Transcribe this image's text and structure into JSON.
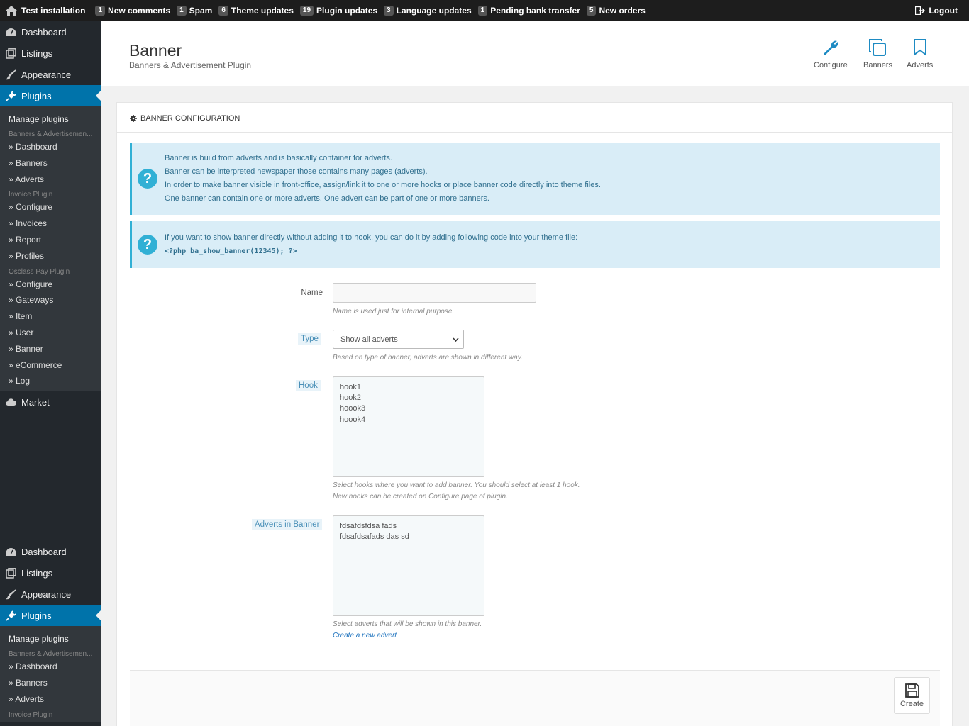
{
  "topbar": {
    "site_name": "Test installation",
    "notifications": [
      {
        "count": "1",
        "label": "New comments"
      },
      {
        "count": "1",
        "label": "Spam"
      },
      {
        "count": "6",
        "label": "Theme updates"
      },
      {
        "count": "19",
        "label": "Plugin updates"
      },
      {
        "count": "3",
        "label": "Language updates"
      },
      {
        "count": "1",
        "label": "Pending bank transfer"
      },
      {
        "count": "5",
        "label": "New orders"
      }
    ],
    "logout": "Logout"
  },
  "sidebar": {
    "main": [
      "Dashboard",
      "Listings",
      "Appearance",
      "Plugins"
    ],
    "manage_plugins": "Manage plugins",
    "groups": [
      {
        "title": "Banners & Advertisemen...",
        "items": [
          "» Dashboard",
          "» Banners",
          "» Adverts"
        ]
      },
      {
        "title": "Invoice Plugin",
        "items": [
          "» Configure",
          "» Invoices",
          "» Report",
          "» Profiles"
        ]
      },
      {
        "title": "Osclass Pay Plugin",
        "items": [
          "» Configure",
          "» Gateways",
          "» Item",
          "» User",
          "» Banner",
          "» eCommerce",
          "» Log"
        ]
      }
    ],
    "market": "Market",
    "repeat_main": [
      "Dashboard",
      "Listings",
      "Appearance",
      "Plugins"
    ],
    "repeat_manage": "Manage plugins",
    "repeat_group_title": "Banners & Advertisemen...",
    "repeat_items": [
      "» Dashboard",
      "» Banners",
      "» Adverts"
    ],
    "repeat_group2_title": "Invoice Plugin"
  },
  "header": {
    "title": "Banner",
    "subtitle": "Banners & Advertisement Plugin",
    "buttons": [
      "Configure",
      "Banners",
      "Adverts"
    ]
  },
  "panel": {
    "title": "Banner configuration",
    "info1": [
      "Banner is build from adverts and is basically container for adverts.",
      "Banner can be interpreted newspaper those contains many pages (adverts).",
      "In order to make banner visible in front-office, assign/link it to one or more hooks or place banner code directly into theme files.",
      "One banner can contain one or more adverts. One advert can be part of one or more banners."
    ],
    "info2_text": "If you want to show banner directly without adding it to hook, you can do it by adding following code into your theme file:",
    "info2_code": "<?php ba_show_banner(12345); ?>"
  },
  "form": {
    "name_label": "Name",
    "name_value": "",
    "name_help": "Name is used just for internal purpose.",
    "type_label": "Type",
    "type_value": "Show all adverts",
    "type_help": "Based on type of banner, adverts are shown in different way.",
    "hook_label": "Hook",
    "hooks": [
      "hook1",
      "hook2",
      "hoook3",
      "hoook4"
    ],
    "hook_help": [
      "Select hooks where you want to add banner. You should select at least 1 hook.",
      "New hooks can be created on Configure page of plugin."
    ],
    "adverts_label": "Adverts in Banner",
    "adverts": [
      "fdsafdsfdsa fads",
      "fdsafdsafads das sd"
    ],
    "adverts_help": "Select adverts that will be shown in this banner.",
    "adverts_link": "Create a new advert",
    "create_button": "Create"
  }
}
